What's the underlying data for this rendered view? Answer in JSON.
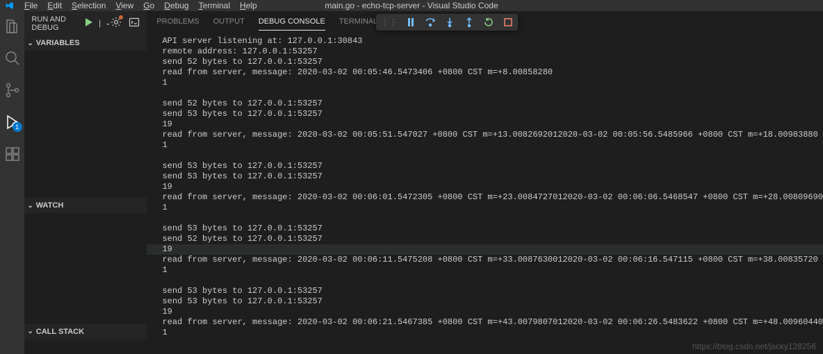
{
  "menubar": {
    "file": "File",
    "edit": "Edit",
    "selection": "Selection",
    "view": "View",
    "go": "Go",
    "debug": "Debug",
    "terminal": "Terminal",
    "help": "Help"
  },
  "window_title": "main.go - echo-tcp-server - Visual Studio Code",
  "activity": {
    "debug_badge": "1"
  },
  "sidebar": {
    "title": "RUN AND DEBUG",
    "config_sep": "|",
    "variables": "Variables",
    "watch": "Watch",
    "callstack": "Call Stack"
  },
  "panel": {
    "problems": "Problems",
    "output": "Output",
    "debug_console": "Debug Console",
    "terminal": "Terminal"
  },
  "console_lines": [
    "API server listening at: 127.0.0.1:30843",
    "remote address: 127.0.0.1:53257",
    "send 52 bytes to 127.0.0.1:53257",
    "read from server, message: 2020-03-02 00:05:46.5473406 +0800 CST m=+8.00858280",
    "1",
    "",
    "send 52 bytes to 127.0.0.1:53257",
    "send 53 bytes to 127.0.0.1:53257",
    "19",
    "read from server, message: 2020-03-02 00:05:51.547027 +0800 CST m=+13.0082692012020-03-02 00:05:56.5485966 +0800 CST m=+18.00983880",
    "1",
    "",
    "send 53 bytes to 127.0.0.1:53257",
    "send 53 bytes to 127.0.0.1:53257",
    "19",
    "read from server, message: 2020-03-02 00:06:01.5472305 +0800 CST m=+23.0084727012020-03-02 00:06:06.5468547 +0800 CST m=+28.00809690",
    "1",
    "",
    "send 53 bytes to 127.0.0.1:53257",
    "send 52 bytes to 127.0.0.1:53257",
    "19",
    "read from server, message: 2020-03-02 00:06:11.5475208 +0800 CST m=+33.0087630012020-03-02 00:06:16.547115 +0800 CST m=+38.00835720",
    "1",
    "",
    "send 53 bytes to 127.0.0.1:53257",
    "send 53 bytes to 127.0.0.1:53257",
    "19",
    "read from server, message: 2020-03-02 00:06:21.5467385 +0800 CST m=+43.0079807012020-03-02 00:06:26.5483622 +0800 CST m=+48.00960440",
    "1"
  ],
  "highlight_line_index": 20,
  "watermark": "https://blog.csdn.net/jacky128256"
}
